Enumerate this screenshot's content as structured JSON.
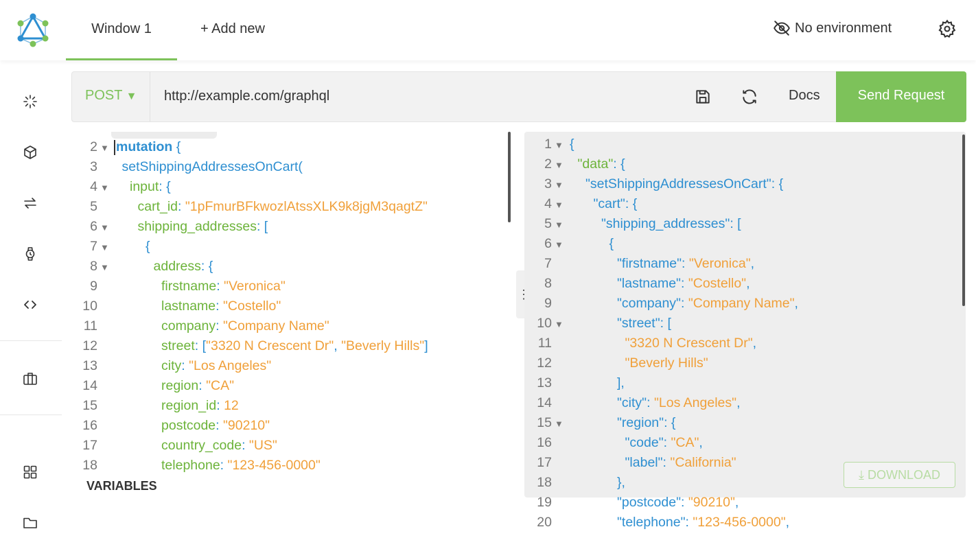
{
  "header": {
    "tabs": [
      {
        "label": "Window 1",
        "active": true
      },
      {
        "label": "+ Add new"
      }
    ],
    "environment": "No environment"
  },
  "sidebar": {
    "icons": [
      "spinner-icon",
      "cube-icon",
      "sync-arrows-icon",
      "watch-icon",
      "code-icon",
      "briefcase-icon",
      "grid-icon",
      "folder-icon"
    ]
  },
  "request": {
    "method": "POST",
    "url": "http://example.com/graphql",
    "docs_label": "Docs",
    "send_label": "Send Request"
  },
  "editor": {
    "lines": [
      {
        "n": "2",
        "fold": true,
        "indent": 0,
        "tokens": [
          [
            "mutation",
            "kw"
          ],
          [
            " {",
            "punc"
          ]
        ]
      },
      {
        "n": "3",
        "fold": false,
        "indent": 1,
        "tokens": [
          [
            "setShippingAddressesOnCart(",
            "blue"
          ]
        ]
      },
      {
        "n": "4",
        "fold": true,
        "indent": 2,
        "tokens": [
          [
            "input",
            "green"
          ],
          [
            ": {",
            "punc"
          ]
        ]
      },
      {
        "n": "5",
        "fold": false,
        "indent": 3,
        "tokens": [
          [
            "cart_id",
            "green"
          ],
          [
            ": ",
            "punc"
          ],
          [
            "\"1pFmurBFkwozlAtssXLK9k8jgM3qagtZ\"",
            "str"
          ]
        ]
      },
      {
        "n": "6",
        "fold": true,
        "indent": 3,
        "tokens": [
          [
            "shipping_addresses",
            "green"
          ],
          [
            ": [",
            "punc"
          ]
        ]
      },
      {
        "n": "7",
        "fold": true,
        "indent": 4,
        "tokens": [
          [
            "{",
            "punc"
          ]
        ]
      },
      {
        "n": "8",
        "fold": true,
        "indent": 5,
        "tokens": [
          [
            "address",
            "green"
          ],
          [
            ": {",
            "punc"
          ]
        ]
      },
      {
        "n": "9",
        "fold": false,
        "indent": 6,
        "tokens": [
          [
            "firstname",
            "green"
          ],
          [
            ": ",
            "punc"
          ],
          [
            "\"Veronica\"",
            "str"
          ]
        ]
      },
      {
        "n": "10",
        "fold": false,
        "indent": 6,
        "tokens": [
          [
            "lastname",
            "green"
          ],
          [
            ": ",
            "punc"
          ],
          [
            "\"Costello\"",
            "str"
          ]
        ]
      },
      {
        "n": "11",
        "fold": false,
        "indent": 6,
        "tokens": [
          [
            "company",
            "green"
          ],
          [
            ": ",
            "punc"
          ],
          [
            "\"Company Name\"",
            "str"
          ]
        ]
      },
      {
        "n": "12",
        "fold": false,
        "indent": 6,
        "tokens": [
          [
            "street",
            "green"
          ],
          [
            ": [",
            "punc"
          ],
          [
            "\"3320 N Crescent Dr\"",
            "str"
          ],
          [
            ", ",
            "punc"
          ],
          [
            "\"Beverly Hills\"",
            "str"
          ],
          [
            "]",
            "punc"
          ]
        ]
      },
      {
        "n": "13",
        "fold": false,
        "indent": 6,
        "tokens": [
          [
            "city",
            "green"
          ],
          [
            ": ",
            "punc"
          ],
          [
            "\"Los Angeles\"",
            "str"
          ]
        ]
      },
      {
        "n": "14",
        "fold": false,
        "indent": 6,
        "tokens": [
          [
            "region",
            "green"
          ],
          [
            ": ",
            "punc"
          ],
          [
            "\"CA\"",
            "str"
          ]
        ]
      },
      {
        "n": "15",
        "fold": false,
        "indent": 6,
        "tokens": [
          [
            "region_id",
            "green"
          ],
          [
            ": ",
            "punc"
          ],
          [
            "12",
            "num"
          ]
        ]
      },
      {
        "n": "16",
        "fold": false,
        "indent": 6,
        "tokens": [
          [
            "postcode",
            "green"
          ],
          [
            ": ",
            "punc"
          ],
          [
            "\"90210\"",
            "str"
          ]
        ]
      },
      {
        "n": "17",
        "fold": false,
        "indent": 6,
        "tokens": [
          [
            "country_code",
            "green"
          ],
          [
            ": ",
            "punc"
          ],
          [
            "\"US\"",
            "str"
          ]
        ]
      },
      {
        "n": "18",
        "fold": false,
        "indent": 6,
        "tokens": [
          [
            "telephone",
            "green"
          ],
          [
            ": ",
            "punc"
          ],
          [
            "\"123-456-0000\"",
            "str"
          ]
        ]
      }
    ],
    "variables_label": "VARIABLES"
  },
  "result": {
    "lines": [
      {
        "n": "1",
        "fold": true,
        "indent": 0,
        "tokens": [
          [
            "{",
            "punc"
          ]
        ]
      },
      {
        "n": "2",
        "fold": true,
        "indent": 1,
        "tokens": [
          [
            "\"data\"",
            "green"
          ],
          [
            ": {",
            "punc"
          ]
        ]
      },
      {
        "n": "3",
        "fold": true,
        "indent": 2,
        "tokens": [
          [
            "\"setShippingAddressesOnCart\"",
            "blue"
          ],
          [
            ": {",
            "punc"
          ]
        ]
      },
      {
        "n": "4",
        "fold": true,
        "indent": 3,
        "tokens": [
          [
            "\"cart\"",
            "blue"
          ],
          [
            ": {",
            "punc"
          ]
        ]
      },
      {
        "n": "5",
        "fold": true,
        "indent": 4,
        "tokens": [
          [
            "\"shipping_addresses\"",
            "blue"
          ],
          [
            ": [",
            "punc"
          ]
        ]
      },
      {
        "n": "6",
        "fold": true,
        "indent": 5,
        "tokens": [
          [
            "{",
            "punc"
          ]
        ]
      },
      {
        "n": "7",
        "fold": false,
        "indent": 6,
        "tokens": [
          [
            "\"firstname\"",
            "blue"
          ],
          [
            ": ",
            "punc"
          ],
          [
            "\"Veronica\"",
            "str"
          ],
          [
            ",",
            "punc"
          ]
        ]
      },
      {
        "n": "8",
        "fold": false,
        "indent": 6,
        "tokens": [
          [
            "\"lastname\"",
            "blue"
          ],
          [
            ": ",
            "punc"
          ],
          [
            "\"Costello\"",
            "str"
          ],
          [
            ",",
            "punc"
          ]
        ]
      },
      {
        "n": "9",
        "fold": false,
        "indent": 6,
        "tokens": [
          [
            "\"company\"",
            "blue"
          ],
          [
            ": ",
            "punc"
          ],
          [
            "\"Company Name\"",
            "str"
          ],
          [
            ",",
            "punc"
          ]
        ]
      },
      {
        "n": "10",
        "fold": true,
        "indent": 6,
        "tokens": [
          [
            "\"street\"",
            "blue"
          ],
          [
            ": [",
            "punc"
          ]
        ]
      },
      {
        "n": "11",
        "fold": false,
        "indent": 7,
        "tokens": [
          [
            "\"3320 N Crescent Dr\"",
            "str"
          ],
          [
            ",",
            "punc"
          ]
        ]
      },
      {
        "n": "12",
        "fold": false,
        "indent": 7,
        "tokens": [
          [
            "\"Beverly Hills\"",
            "str"
          ]
        ]
      },
      {
        "n": "13",
        "fold": false,
        "indent": 6,
        "tokens": [
          [
            "],",
            "punc"
          ]
        ]
      },
      {
        "n": "14",
        "fold": false,
        "indent": 6,
        "tokens": [
          [
            "\"city\"",
            "blue"
          ],
          [
            ": ",
            "punc"
          ],
          [
            "\"Los Angeles\"",
            "str"
          ],
          [
            ",",
            "punc"
          ]
        ]
      },
      {
        "n": "15",
        "fold": true,
        "indent": 6,
        "tokens": [
          [
            "\"region\"",
            "blue"
          ],
          [
            ": {",
            "punc"
          ]
        ]
      },
      {
        "n": "16",
        "fold": false,
        "indent": 7,
        "tokens": [
          [
            "\"code\"",
            "blue"
          ],
          [
            ": ",
            "punc"
          ],
          [
            "\"CA\"",
            "str"
          ],
          [
            ",",
            "punc"
          ]
        ]
      },
      {
        "n": "17",
        "fold": false,
        "indent": 7,
        "tokens": [
          [
            "\"label\"",
            "blue"
          ],
          [
            ": ",
            "punc"
          ],
          [
            "\"California\"",
            "str"
          ]
        ]
      },
      {
        "n": "18",
        "fold": false,
        "indent": 6,
        "tokens": [
          [
            "},",
            "punc"
          ]
        ]
      },
      {
        "n": "19",
        "fold": false,
        "indent": 6,
        "tokens": [
          [
            "\"postcode\"",
            "blue"
          ],
          [
            ": ",
            "punc"
          ],
          [
            "\"90210\"",
            "str"
          ],
          [
            ",",
            "punc"
          ]
        ]
      },
      {
        "n": "20",
        "fold": false,
        "indent": 6,
        "tokens": [
          [
            "\"telephone\"",
            "blue"
          ],
          [
            ": ",
            "punc"
          ],
          [
            "\"123-456-0000\"",
            "str"
          ],
          [
            ",",
            "punc"
          ]
        ]
      }
    ],
    "download_label": "DOWNLOAD"
  },
  "colors": {
    "accent": "#7dc25a",
    "key_blue": "#2e8fd1",
    "key_green": "#6cb33a",
    "string_orange": "#f0a03a"
  }
}
